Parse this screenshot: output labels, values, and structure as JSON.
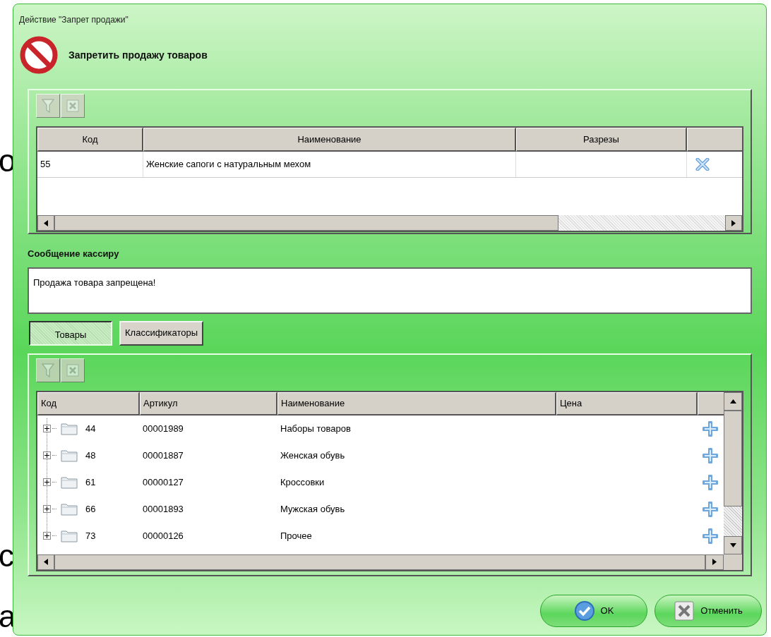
{
  "background_fragments": [
    "о",
    "с",
    "а"
  ],
  "window": {
    "title": "Действие \"Запрет продажи\""
  },
  "header": {
    "title": "Запретить продажу товаров"
  },
  "selected_panel": {
    "toolbar": [
      {
        "kind": "filter",
        "disabled": true
      },
      {
        "kind": "clear",
        "disabled": true
      }
    ],
    "columns": [
      "Код",
      "Наименование",
      "Разрезы"
    ],
    "rows": [
      {
        "code": "55",
        "name": "Женские сапоги с натуральным мехом"
      }
    ]
  },
  "message": {
    "label": "Сообщение кассиру",
    "value": "Продажа товара запрещена!"
  },
  "tabs": [
    {
      "label": "Товары",
      "selected": true
    },
    {
      "label": "Классификаторы",
      "selected": false
    }
  ],
  "catalog_panel": {
    "toolbar": [
      {
        "kind": "filter",
        "disabled": true
      },
      {
        "kind": "clear",
        "disabled": true
      }
    ],
    "columns": [
      "Код",
      "Артикул",
      "Наименование",
      "Цена"
    ],
    "rows": [
      {
        "code": "44",
        "article": "00001989",
        "name": "Наборы товаров",
        "expanded": false
      },
      {
        "code": "48",
        "article": "00001887",
        "name": "Женская обувь",
        "expanded": false
      },
      {
        "code": "61",
        "article": "00000127",
        "name": "Кроссовки",
        "expanded": false
      },
      {
        "code": "66",
        "article": "00001893",
        "name": "Мужская обувь",
        "expanded": false
      },
      {
        "code": "73",
        "article": "00000126",
        "name": "Прочее",
        "expanded": false
      }
    ]
  },
  "buttons": [
    {
      "kind": "ok",
      "label": "OK"
    },
    {
      "kind": "cancel",
      "label": "Отменить"
    }
  ]
}
